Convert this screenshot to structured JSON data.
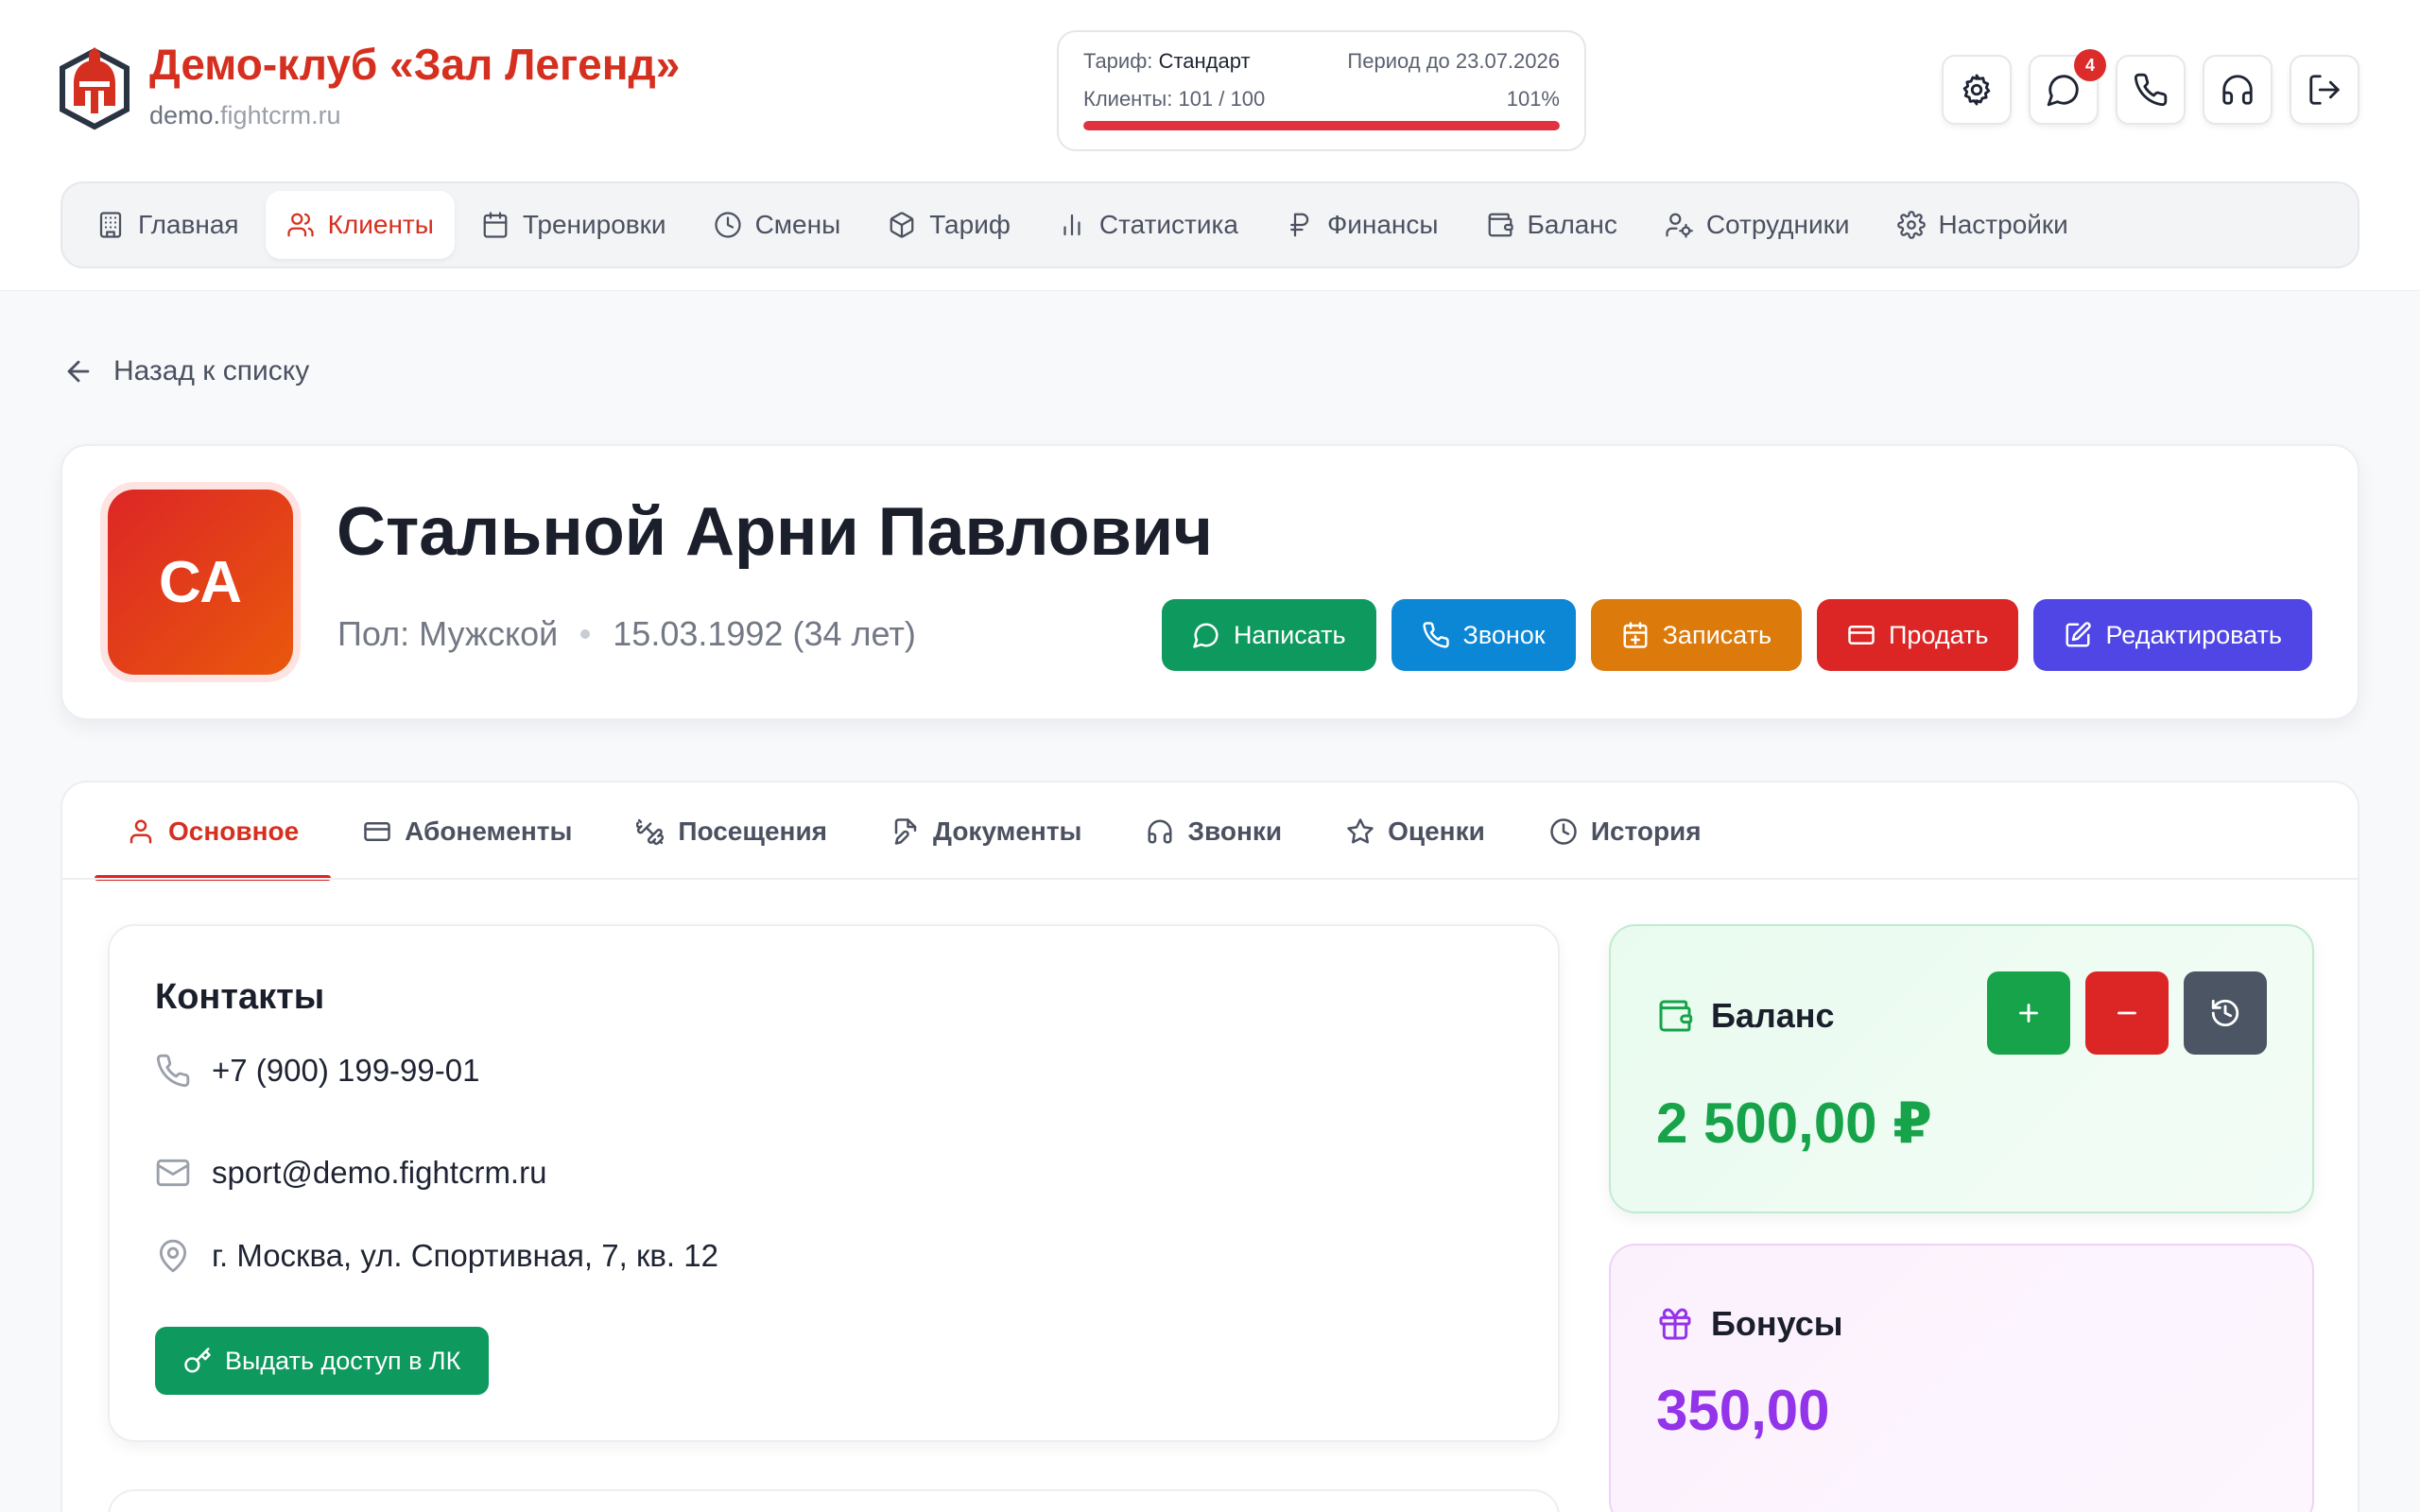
{
  "brand": {
    "title": "Демо-клуб «Зал Легенд»",
    "domain_part1": "demo.",
    "domain_part2": "fightcrm.ru"
  },
  "plan": {
    "tariff_label": "Тариф:",
    "tariff_value": "Стандарт",
    "period": "Период до 23.07.2026",
    "clients_label": "Клиенты:",
    "clients_value": "101 / 100",
    "percent": "101%",
    "usage_fraction": 1.0,
    "bar_color": "#e3323f"
  },
  "header_actions": {
    "items": [
      {
        "name": "settings-icon"
      },
      {
        "name": "chat-icon",
        "badge": "4"
      },
      {
        "name": "phone-icon"
      },
      {
        "name": "headset-icon"
      },
      {
        "name": "logout-icon"
      }
    ]
  },
  "nav": {
    "items": [
      {
        "label": "Главная",
        "icon": "building-icon"
      },
      {
        "label": "Клиенты",
        "icon": "users-icon",
        "active": true
      },
      {
        "label": "Тренировки",
        "icon": "calendar-icon"
      },
      {
        "label": "Смены",
        "icon": "clock-icon"
      },
      {
        "label": "Тариф",
        "icon": "box-icon"
      },
      {
        "label": "Статистика",
        "icon": "bar-chart-icon"
      },
      {
        "label": "Финансы",
        "icon": "ruble-icon"
      },
      {
        "label": "Баланс",
        "icon": "wallet-icon"
      },
      {
        "label": "Сотрудники",
        "icon": "user-cog-icon"
      },
      {
        "label": "Настройки",
        "icon": "gear-icon"
      }
    ]
  },
  "back": {
    "label": "Назад к списку"
  },
  "profile": {
    "initials": "СА",
    "name": "Стальной Арни Павлович",
    "gender": "Пол: Мужской",
    "birth": "15.03.1992 (34 лет)",
    "buttons": [
      {
        "label": "Написать",
        "color": "#0e9a5e",
        "icon": "message-icon"
      },
      {
        "label": "Звонок",
        "color": "#0b87d6",
        "icon": "phone-icon"
      },
      {
        "label": "Записать",
        "color": "#dc7a0b",
        "icon": "calendar-plus-icon"
      },
      {
        "label": "Продать",
        "color": "#dc2626",
        "icon": "card-icon"
      },
      {
        "label": "Редактировать",
        "color": "#4f46e5",
        "icon": "edit-icon"
      }
    ]
  },
  "tabs": {
    "items": [
      {
        "label": "Основное",
        "icon": "user-icon",
        "active": true
      },
      {
        "label": "Абонементы",
        "icon": "card-icon"
      },
      {
        "label": "Посещения",
        "icon": "dumbbell-icon"
      },
      {
        "label": "Документы",
        "icon": "document-edit-icon"
      },
      {
        "label": "Звонки",
        "icon": "headset-icon"
      },
      {
        "label": "Оценки",
        "icon": "star-icon"
      },
      {
        "label": "История",
        "icon": "clock-icon"
      }
    ]
  },
  "contacts": {
    "title": "Контакты",
    "phone": "+7 (900) 199-99-01",
    "email": "sport@demo.fightcrm.ru",
    "address": "г. Москва, ул. Спортивная, 7, кв. 12",
    "access_button": "Выдать доступ в ЛК"
  },
  "balance": {
    "title": "Баланс",
    "value": "2 500,00 ₽",
    "accent": "#16a34a"
  },
  "bonus": {
    "title": "Бонусы",
    "value": "350,00",
    "accent": "#9333ea"
  },
  "colors": {
    "brand": "#d5301f",
    "add": "#16a34a",
    "subtract": "#dc2626",
    "history": "#4b5563"
  }
}
